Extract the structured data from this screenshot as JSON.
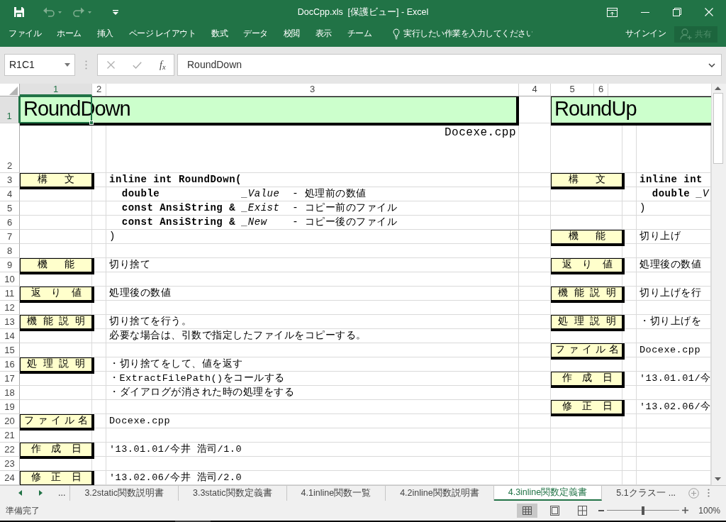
{
  "window": {
    "title": "DocCpp.xls  [保護ビュー] - Excel"
  },
  "quick_access": [
    {
      "kind": "save",
      "disabled": false
    },
    {
      "kind": "undo",
      "disabled": true
    },
    {
      "kind": "redo",
      "disabled": true
    },
    {
      "kind": "customize",
      "disabled": false
    }
  ],
  "ribbon_tabs": [
    {
      "label": "ファイル",
      "selected": false
    },
    {
      "label": "ホーム",
      "selected": false
    },
    {
      "label": "挿入",
      "selected": false
    },
    {
      "label": "ページ レイアウト",
      "selected": false
    },
    {
      "label": "数式",
      "selected": false
    },
    {
      "label": "データ",
      "selected": false
    },
    {
      "label": "校閲",
      "selected": false
    },
    {
      "label": "表示",
      "selected": false
    },
    {
      "label": "チーム",
      "selected": false
    }
  ],
  "tell_me": {
    "placeholder": "実行したい作業を入力してください"
  },
  "sign_in": "サインイン",
  "share": {
    "label": "共有",
    "disabled": true
  },
  "name_box": {
    "value": "R1C1"
  },
  "formula_bar": {
    "cancel_disabled": true,
    "enter_disabled": true,
    "function_label": "f$_{x}$",
    "value": "RoundDown"
  },
  "column_headers": [
    {
      "label": "1",
      "selected": true
    },
    {
      "label": "2",
      "selected": false
    },
    {
      "label": "3",
      "selected": false
    },
    {
      "label": "4",
      "selected": false
    },
    {
      "label": "5",
      "selected": false
    },
    {
      "label": "6",
      "selected": false
    }
  ],
  "row_headers": [
    {
      "label": "1",
      "selected": true
    },
    {
      "label": "2",
      "selected": false
    },
    {
      "label": "3",
      "selected": false
    },
    {
      "label": "4",
      "selected": false
    },
    {
      "label": "5",
      "selected": false
    },
    {
      "label": "6",
      "selected": false
    },
    {
      "label": "7",
      "selected": false
    },
    {
      "label": "8",
      "selected": false
    },
    {
      "label": "9",
      "selected": false
    },
    {
      "label": "10",
      "selected": false
    },
    {
      "label": "11",
      "selected": false
    },
    {
      "label": "12",
      "selected": false
    },
    {
      "label": "13",
      "selected": false
    },
    {
      "label": "14",
      "selected": false
    },
    {
      "label": "15",
      "selected": false
    },
    {
      "label": "16",
      "selected": false
    },
    {
      "label": "17",
      "selected": false
    },
    {
      "label": "18",
      "selected": false
    },
    {
      "label": "19",
      "selected": false
    },
    {
      "label": "20",
      "selected": false
    },
    {
      "label": "21",
      "selected": false
    },
    {
      "label": "22",
      "selected": false
    },
    {
      "label": "23",
      "selected": false
    },
    {
      "label": "24",
      "selected": false
    }
  ],
  "blocks": [
    {
      "title": "RoundDown",
      "file_name": "Docexe.cpp",
      "sections": [
        {
          "kind": "syntax",
          "label": "構文",
          "signature": "inline int RoundDown(",
          "params": [
            "  **double**             *_Value*  - 処理前の数値",
            "  **const AnsiString &** *_Exist*  - コピー前のファイル",
            "  **const AnsiString &** *_New*    - コピー後のファイル"
          ],
          "closing": ")"
        },
        {
          "kind": "text",
          "label": "機能",
          "lines": [
            "切り捨て"
          ]
        },
        {
          "kind": "text",
          "label": "返り値",
          "lines": [
            "処理後の数値"
          ]
        },
        {
          "kind": "text",
          "label": "機能説明",
          "lines": [
            "切り捨てを行う。",
            "必要な場合は、引数で指定したファイルをコピーする。"
          ]
        },
        {
          "kind": "text",
          "label": "処理説明",
          "lines": [
            "・切り捨てをして、値を返す",
            "・ExtractFilePath()をコールする",
            "・ダイアログが消された時の処理をする"
          ]
        },
        {
          "kind": "text",
          "label": "ファイル名",
          "lines": [
            "Docexe.cpp"
          ]
        },
        {
          "kind": "text",
          "label": "作成日",
          "lines": [
            "'13.01.01/今井 浩司/1.0"
          ]
        },
        {
          "kind": "text",
          "label": "修正日",
          "lines": [
            "'13.02.06/今井 浩司/2.0"
          ]
        }
      ]
    },
    {
      "title": "RoundUp",
      "sections": [
        {
          "kind": "syntax",
          "label": "構文",
          "signature": "inline int",
          "params": [
            "  **double** *_V*"
          ],
          "closing": ")"
        },
        {
          "kind": "text",
          "label": "機能",
          "lines": [
            "切り上げ"
          ]
        },
        {
          "kind": "text",
          "label": "返り値",
          "lines": [
            "処理後の数値"
          ]
        },
        {
          "kind": "text",
          "label": "機能説明",
          "lines": [
            "切り上げを行"
          ]
        },
        {
          "kind": "text",
          "label": "処理説明",
          "lines": [
            "・切り上げを"
          ]
        },
        {
          "kind": "text",
          "label": "ファイル名",
          "lines": [
            "Docexe.cpp"
          ]
        },
        {
          "kind": "text",
          "label": "作成日",
          "lines": [
            "'13.01.01/今"
          ]
        },
        {
          "kind": "text",
          "label": "修正日",
          "lines": [
            "'13.02.06/今"
          ]
        }
      ]
    }
  ],
  "sheet_tabs": {
    "more_left": "...",
    "tabs": [
      {
        "label": "3.2static関数説明書",
        "selected": false
      },
      {
        "label": "3.3static関数定義書",
        "selected": false
      },
      {
        "label": "4.1inline関数一覧",
        "selected": false
      },
      {
        "label": "4.2inline関数説明書",
        "selected": false
      },
      {
        "label": "4.3inline関数定義書",
        "selected": true
      },
      {
        "label": "5.1クラス一",
        "selected": false
      }
    ],
    "more_right": "..."
  },
  "status_bar": {
    "text": "準備完了",
    "views": [
      {
        "kind": "normal",
        "selected": true
      },
      {
        "kind": "page_layout",
        "selected": false
      },
      {
        "kind": "page_break",
        "selected": false
      }
    ],
    "zoom": {
      "level": 0.5,
      "reading": "100%"
    }
  }
}
